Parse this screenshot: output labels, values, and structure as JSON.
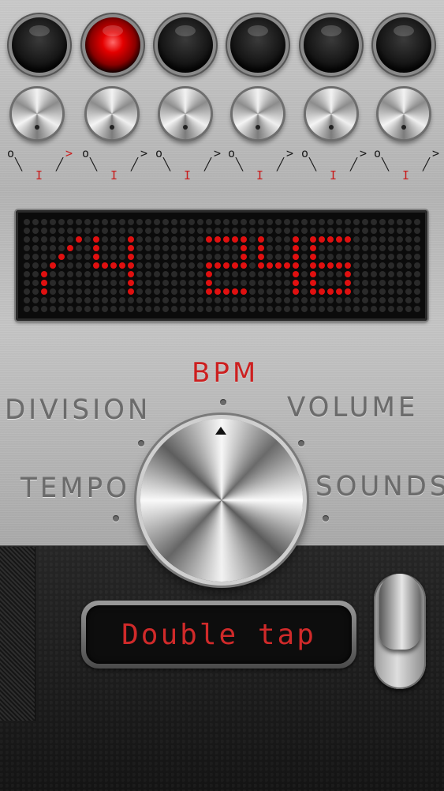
{
  "indicators": {
    "leds": [
      {
        "state": "off"
      },
      {
        "state": "on"
      },
      {
        "state": "off"
      },
      {
        "state": "off"
      },
      {
        "state": "off"
      },
      {
        "state": "off"
      }
    ],
    "colors": {
      "led_on": "#e40000",
      "display_on": "#e01010",
      "display_off": "#2a2a2a"
    }
  },
  "knobs": [
    {
      "scale": {
        "left": "o",
        "mid": "I",
        "right": ">"
      }
    },
    {
      "scale": {
        "left": "o",
        "mid": "I",
        "right": ">"
      }
    },
    {
      "scale": {
        "left": "o",
        "mid": "I",
        "right": ">"
      }
    },
    {
      "scale": {
        "left": "o",
        "mid": "I",
        "right": ">"
      }
    },
    {
      "scale": {
        "left": "o",
        "mid": "I",
        "right": ">"
      }
    },
    {
      "scale": {
        "left": "o",
        "mid": "I",
        "right": ">"
      }
    }
  ],
  "display": {
    "beat": "/4",
    "tempo": "246"
  },
  "dial": {
    "labels": {
      "bpm": "BPM",
      "division": "DIVISION",
      "volume": "VOLUME",
      "tempo": "TEMPO",
      "sounds": "SOUNDS"
    },
    "selected": "BPM"
  },
  "tap": {
    "label": "Double tap"
  },
  "toggle": {
    "state": "on"
  }
}
